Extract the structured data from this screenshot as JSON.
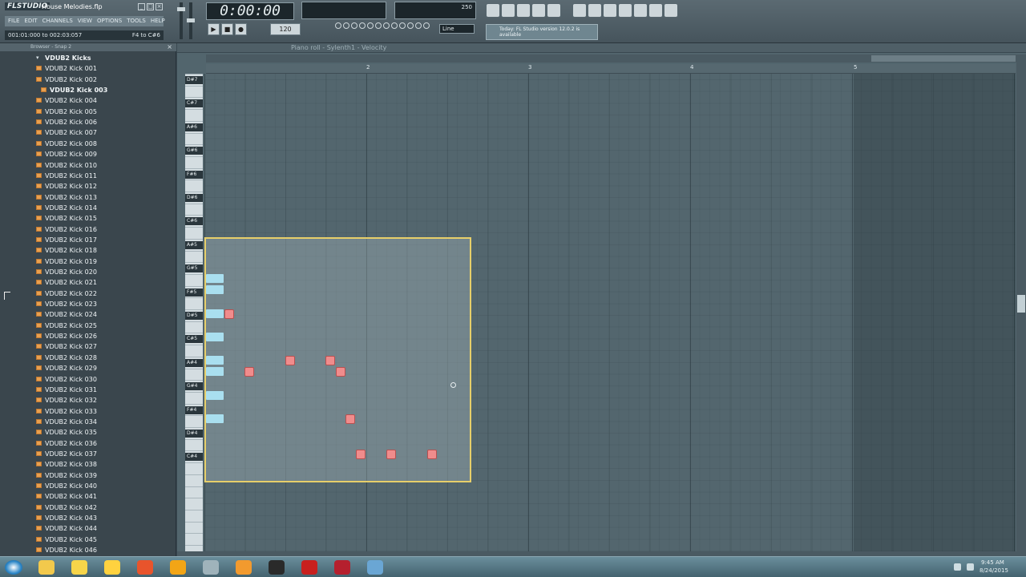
{
  "app": {
    "logo": "FLSTUDIO",
    "project_name": "House Melodies.flp",
    "menus": [
      "FILE",
      "EDIT",
      "CHANNELS",
      "VIEW",
      "OPTIONS",
      "TOOLS",
      "HELP"
    ],
    "hint_time": "001:01:000 to 002:03:057",
    "hint_range": "F4 to C#6"
  },
  "transport": {
    "time": "0:00:00",
    "play_icon": "play-icon",
    "stop_icon": "stop-icon",
    "record_icon": "record-icon",
    "pattern_label": "120",
    "tempo": "250"
  },
  "snap": {
    "value": "Line"
  },
  "news": {
    "text": "Today: FL Studio version 12.0.2 is available"
  },
  "browser": {
    "title": "Browser - Snap 2",
    "folder": "VDUB2 Kicks",
    "items": [
      "VDUB2 Kick 001",
      "VDUB2 Kick 002",
      "VDUB2 Kick 003",
      "VDUB2 Kick 004",
      "VDUB2 Kick 005",
      "VDUB2 Kick 006",
      "VDUB2 Kick 007",
      "VDUB2 Kick 008",
      "VDUB2 Kick 009",
      "VDUB2 Kick 010",
      "VDUB2 Kick 011",
      "VDUB2 Kick 012",
      "VDUB2 Kick 013",
      "VDUB2 Kick 014",
      "VDUB2 Kick 015",
      "VDUB2 Kick 016",
      "VDUB2 Kick 017",
      "VDUB2 Kick 018",
      "VDUB2 Kick 019",
      "VDUB2 Kick 020",
      "VDUB2 Kick 021",
      "VDUB2 Kick 022",
      "VDUB2 Kick 023",
      "VDUB2 Kick 024",
      "VDUB2 Kick 025",
      "VDUB2 Kick 026",
      "VDUB2 Kick 027",
      "VDUB2 Kick 028",
      "VDUB2 Kick 029",
      "VDUB2 Kick 030",
      "VDUB2 Kick 031",
      "VDUB2 Kick 032",
      "VDUB2 Kick 033",
      "VDUB2 Kick 034",
      "VDUB2 Kick 035",
      "VDUB2 Kick 036",
      "VDUB2 Kick 037",
      "VDUB2 Kick 038",
      "VDUB2 Kick 039",
      "VDUB2 Kick 040",
      "VDUB2 Kick 041",
      "VDUB2 Kick 042",
      "VDUB2 Kick 043",
      "VDUB2 Kick 044",
      "VDUB2 Kick 045",
      "VDUB2 Kick 046"
    ],
    "selected_index": 2
  },
  "piano_roll": {
    "title": "Piano roll - Sylenth1 - Velocity",
    "bars": [
      "2",
      "3",
      "4",
      "5"
    ],
    "octave_labels": [
      "D#7",
      "C#7",
      "A#6",
      "G#6",
      "F#6",
      "D#6",
      "C#6",
      "A#5",
      "G#5",
      "F#5",
      "D#5",
      "C#5",
      "A#4",
      "G#4",
      "F#4",
      "D#4",
      "C#4"
    ]
  },
  "taskbar": {
    "time": "9:45 AM",
    "date": "8/24/2015",
    "icons": [
      "explorer-icon",
      "norton-icon",
      "chrome-icon",
      "firefox-icon",
      "audio-icon",
      "fl-studio-icon",
      "media-player-icon",
      "steam-icon",
      "game-icon",
      "mcafee-icon",
      "window-icon"
    ]
  },
  "colors": {
    "note": "#f08c8c",
    "ghost_note": "#a9dfef",
    "selection_border": "#e7cf6a",
    "folder_icon": "#e8a050"
  }
}
